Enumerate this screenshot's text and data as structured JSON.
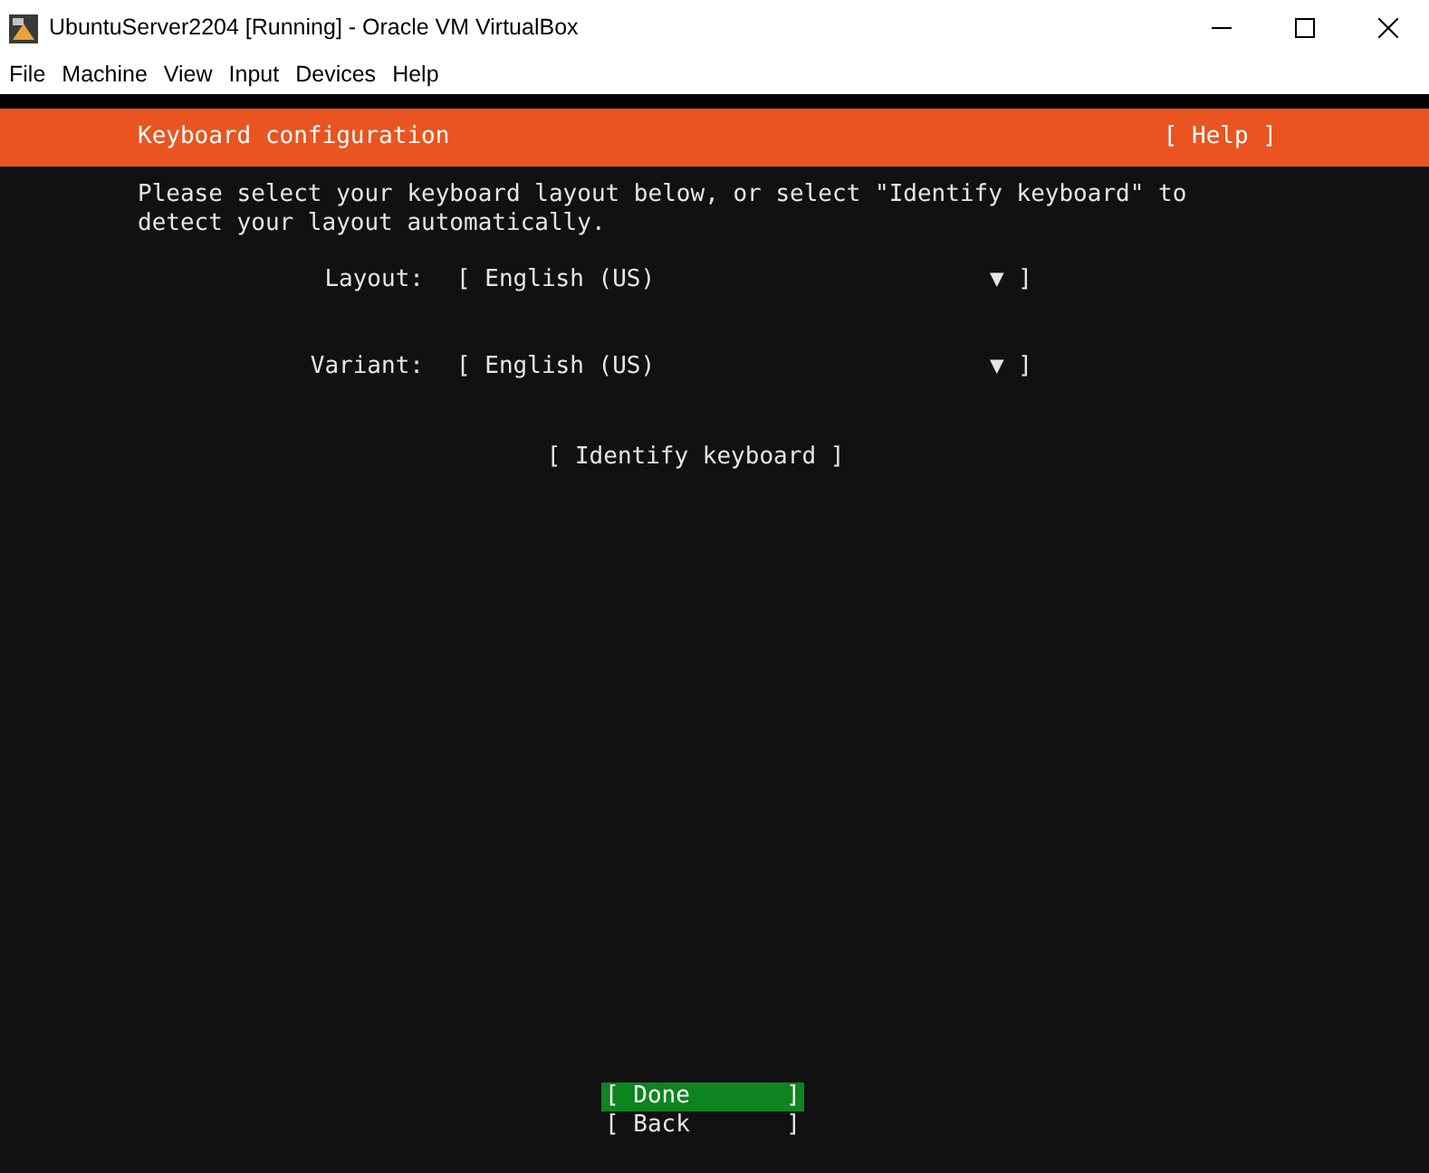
{
  "window": {
    "title": "UbuntuServer2204 [Running] - Oracle VM VirtualBox"
  },
  "menu": [
    "File",
    "Machine",
    "View",
    "Input",
    "Devices",
    "Help"
  ],
  "header": {
    "title": "Keyboard configuration",
    "help": "[ Help ]"
  },
  "intro": "Please select your keyboard layout below, or select \"Identify keyboard\" to detect your layout automatically.",
  "fields": [
    {
      "label": "Layout:",
      "open": "[",
      "value": "English (US)",
      "close": "▼ ]"
    },
    {
      "label": "Variant:",
      "open": "[",
      "value": "English (US)",
      "close": "▼ ]"
    }
  ],
  "identify_button": "[ Identify keyboard ]",
  "buttons": [
    {
      "open": "[",
      "label": "Done",
      "close": "]",
      "selected": true
    },
    {
      "open": "[",
      "label": "Back",
      "close": "]",
      "selected": false
    }
  ]
}
